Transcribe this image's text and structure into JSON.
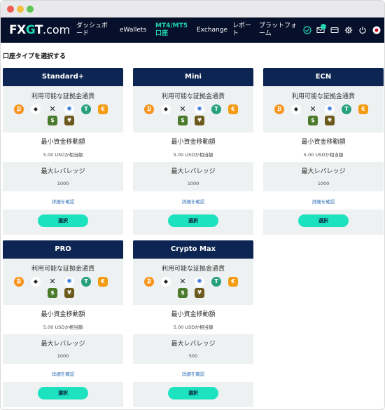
{
  "nav": {
    "logo_prefix": "FX",
    "logo_g": "G",
    "logo_suffix": "T",
    "logo_dotcom": ".com",
    "items": [
      {
        "label_line1": "ダッシュボ",
        "label_line2": "ード"
      },
      {
        "label_line1": "eWallets",
        "label_line2": ""
      },
      {
        "label_line1": "MT4/MT5",
        "label_line2": "口座"
      },
      {
        "label_line1": "Exchange",
        "label_line2": ""
      },
      {
        "label_line1": "レポー",
        "label_line2": "ト"
      },
      {
        "label_line1": "プラットフォ",
        "label_line2": "ーム"
      }
    ],
    "icons": [
      "check-circle-icon",
      "mail-icon",
      "card-icon",
      "gear-icon",
      "power-icon",
      "japan-flag-icon"
    ]
  },
  "page_title": "口座タイプを選択する",
  "labels": {
    "currencies": "利用可能な証拠金通貨",
    "min_transfer": "最小資金移動額",
    "max_leverage": "最大レバレッジ",
    "details_link": "詳細を確認",
    "select_button": "選択"
  },
  "coins_row1": [
    {
      "name": "bitcoin-icon",
      "glyph": "₿"
    },
    {
      "name": "ethereum-icon",
      "glyph": "◆"
    },
    {
      "name": "xrp-icon",
      "glyph": "✕"
    },
    {
      "name": "cardano-icon",
      "glyph": "✺"
    },
    {
      "name": "tether-icon",
      "glyph": "T"
    },
    {
      "name": "euro-icon",
      "glyph": "€"
    }
  ],
  "coins_row2": [
    {
      "name": "usd-icon",
      "glyph": "$"
    },
    {
      "name": "jpy-icon",
      "glyph": "¥"
    }
  ],
  "cards": [
    {
      "name": "Standard+",
      "min_transfer": "5.00 USDか相当額",
      "max_leverage": "1000"
    },
    {
      "name": "Mini",
      "min_transfer": "5.00 USDか相当額",
      "max_leverage": "1000"
    },
    {
      "name": "ECN",
      "min_transfer": "5.00 USDか相当額",
      "max_leverage": "1000"
    },
    {
      "name": "PRO",
      "min_transfer": "5.00 USDか相当額",
      "max_leverage": "1000"
    },
    {
      "name": "Crypto Max",
      "min_transfer": "5.00 USDか相当額",
      "max_leverage": "500"
    }
  ],
  "colors": {
    "nav_bg": "#07102a",
    "accent": "#21d6b0",
    "card_header": "#0d2552",
    "button": "#1de2c0",
    "link": "#2d6fb7"
  }
}
